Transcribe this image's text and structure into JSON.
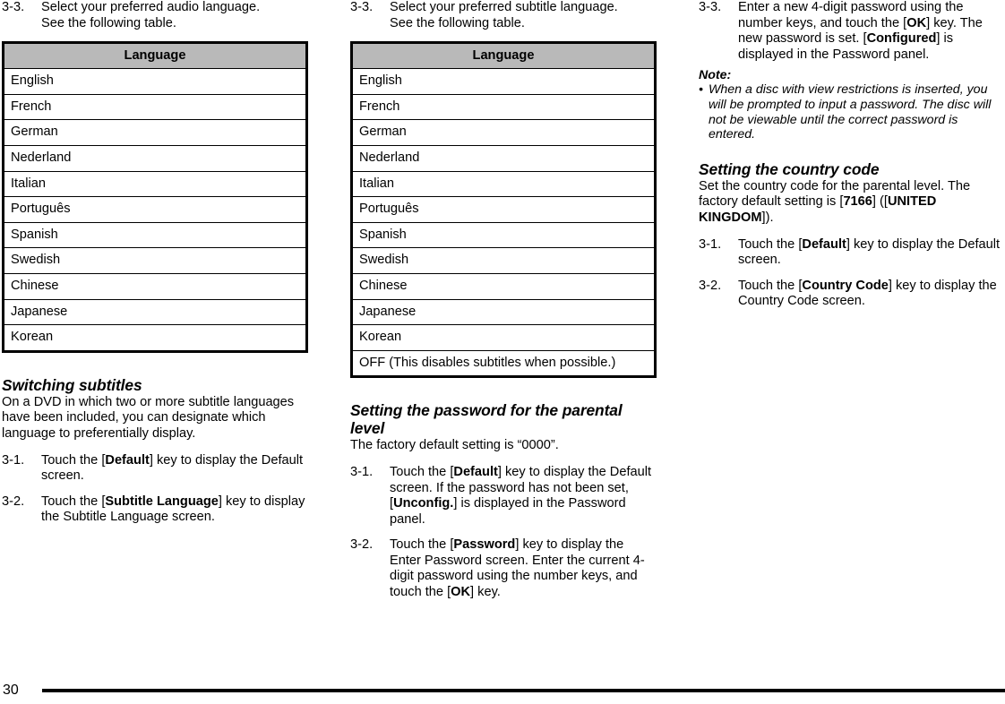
{
  "page": {
    "number": "30"
  },
  "columns": {
    "left": {
      "step_audio": {
        "num": "3-3.",
        "line1": "Select your preferred audio language.",
        "line2": "See the following table."
      },
      "audio_table": {
        "header": "Language",
        "rows": [
          "English",
          "French",
          "German",
          "Nederland",
          "Italian",
          "Português",
          "Spanish",
          "Swedish",
          "Chinese",
          "Japanese",
          "Korean"
        ]
      },
      "switching_subtitles": {
        "heading": "Switching subtitles",
        "intro": "On a DVD in which two or more subtitle languages have been included, you can designate which language to preferentially display.",
        "steps": [
          {
            "num": "3-1.",
            "pre": "Touch the [",
            "key": "Default",
            "post": "] key to display the Default screen."
          },
          {
            "num": "3-2.",
            "pre": "Touch the [",
            "key": "Subtitle Language",
            "post": "] key to display the Subtitle Language screen."
          }
        ]
      }
    },
    "middle": {
      "step_subtitle": {
        "num": "3-3.",
        "line1": "Select your preferred subtitle language.",
        "line2": "See the following table."
      },
      "subtitle_table": {
        "header": "Language",
        "rows": [
          "English",
          "French",
          "German",
          "Nederland",
          "Italian",
          "Português",
          "Spanish",
          "Swedish",
          "Chinese",
          "Japanese",
          "Korean",
          "OFF (This disables subtitles when possible.)"
        ]
      },
      "password_section": {
        "heading": "Setting the password for the parental level",
        "intro": "The factory default setting is “0000”.",
        "step1": {
          "num": "3-1.",
          "seg1": "Touch the [",
          "key1": "Default",
          "seg2": "] key to display the Default screen. If the password has not been set, [",
          "key2": "Unconfig.",
          "seg3": "] is displayed in the Password panel."
        },
        "step2": {
          "num": "3-2.",
          "seg1": "Touch the [",
          "key1": "Password",
          "seg2": "] key to display the Enter Password screen. Enter the current 4-digit password using the number keys, and touch the [",
          "key2": "OK",
          "seg3": "] key."
        }
      }
    },
    "right": {
      "step3": {
        "num": "3-3.",
        "seg1": "Enter a new 4-digit password using the number keys, and touch the [",
        "key1": "OK",
        "seg2": "] key. The new password is set. [",
        "key2": "Configured",
        "seg3": "] is displayed in the Password panel."
      },
      "note": {
        "title": "Note:",
        "bullet": "•",
        "items": [
          "When a disc with view restrictions is inserted, you will be prompted to input a password. The disc will not be viewable until the correct password is entered."
        ]
      },
      "country_section": {
        "heading": "Setting the country code",
        "intro_seg1": "Set the country code for the parental level. The factory default setting is [",
        "intro_key1": "7166",
        "intro_seg2": "] ([",
        "intro_key2": "UNITED KINGDOM",
        "intro_seg3": "]).",
        "steps": [
          {
            "num": "3-1.",
            "pre": "Touch the [",
            "key": "Default",
            "post": "] key to display the Default screen."
          },
          {
            "num": "3-2.",
            "pre": "Touch the [",
            "key": "Country Code",
            "post": "] key to display the Country Code screen."
          }
        ]
      }
    }
  }
}
